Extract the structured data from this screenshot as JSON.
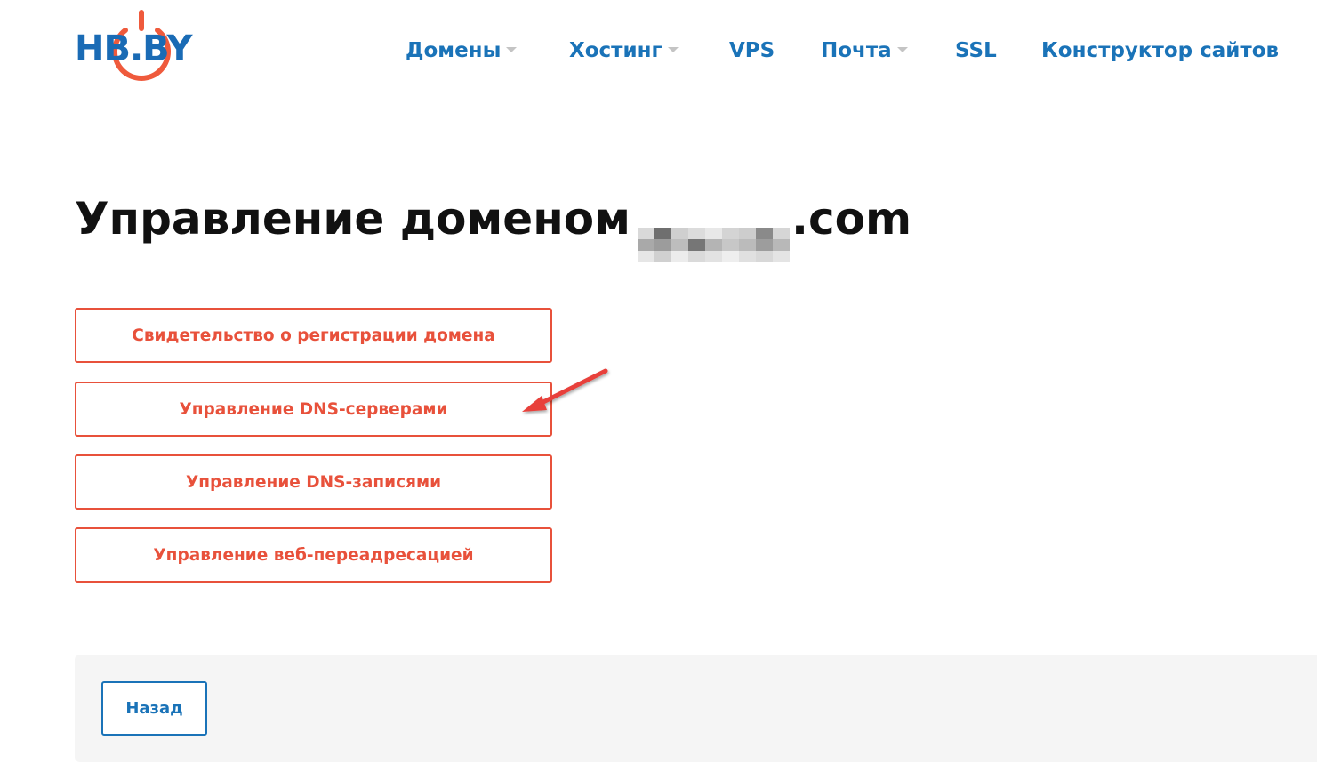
{
  "header": {
    "logo_text": "HB.BY",
    "logo_colors": {
      "text": "#1a6bb5",
      "ring": "#ef5a3c"
    },
    "nav": [
      {
        "label": "Домены",
        "dropdown": true
      },
      {
        "label": "Хостинг",
        "dropdown": true
      },
      {
        "label": "VPS",
        "dropdown": false
      },
      {
        "label": "Почта",
        "dropdown": true
      },
      {
        "label": "SSL",
        "dropdown": false
      },
      {
        "label": "Конструктор сайтов",
        "dropdown": false
      }
    ]
  },
  "main": {
    "title_prefix": "Управление доменом",
    "title_suffix": ".com",
    "actions": [
      {
        "label": "Свидетельство о регистрации домена"
      },
      {
        "label": "Управление DNS-серверами"
      },
      {
        "label": "Управление DNS-записями"
      },
      {
        "label": "Управление веб-переадресацией"
      }
    ]
  },
  "footer": {
    "back_label": "Назад"
  },
  "colors": {
    "accent_red": "#e8513b",
    "nav_blue": "#1a73b8",
    "title": "#111111",
    "panel_bg": "#f5f5f5"
  }
}
